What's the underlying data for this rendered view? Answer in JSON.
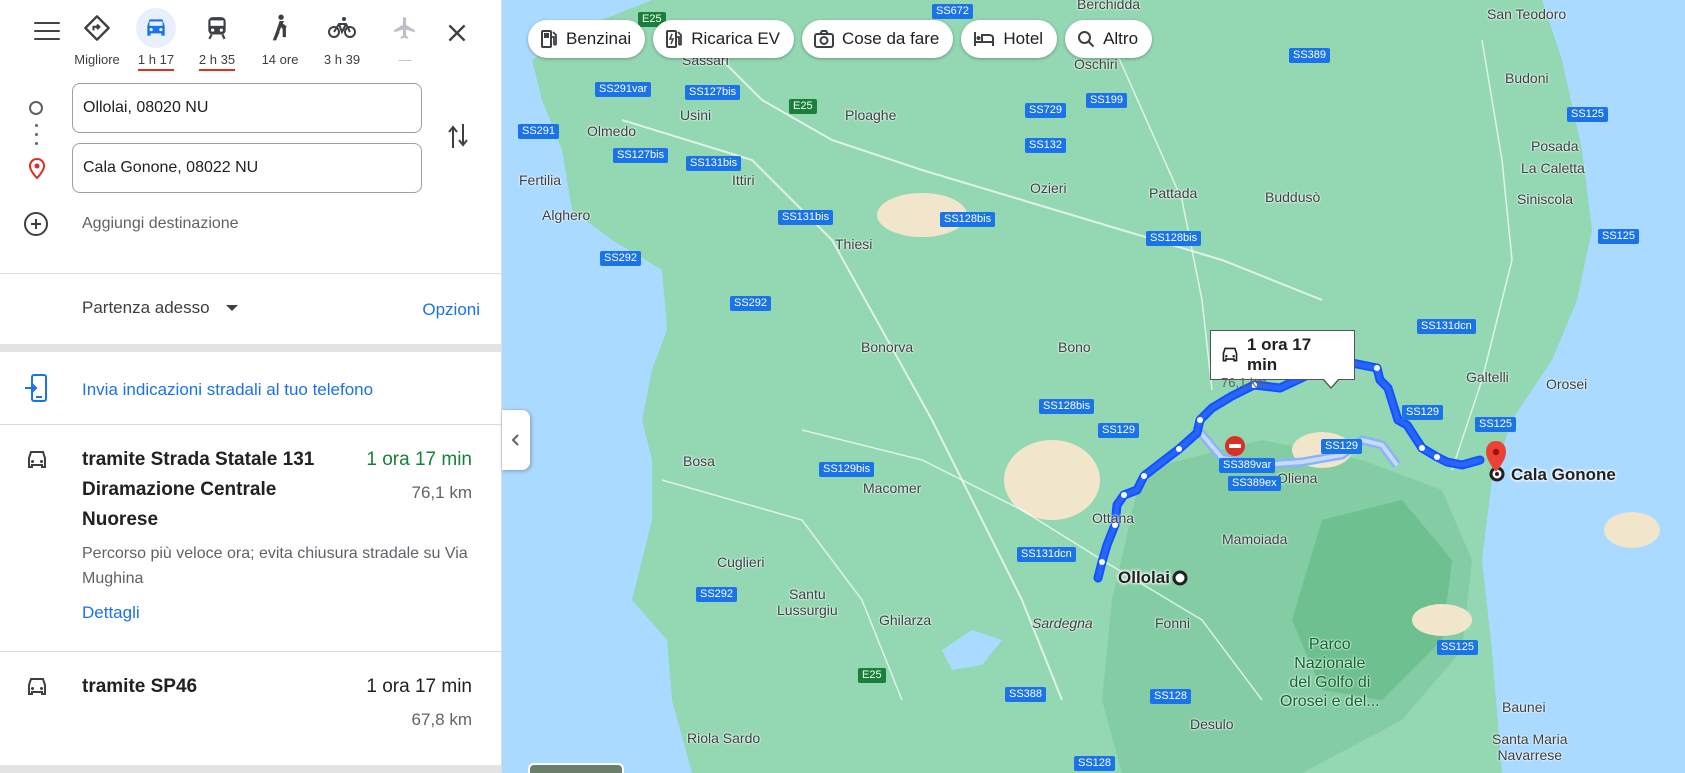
{
  "travel_modes": [
    {
      "name": "best",
      "label": "Migliore"
    },
    {
      "name": "car",
      "label": "1 h 17"
    },
    {
      "name": "transit",
      "label": "2 h 35"
    },
    {
      "name": "walk",
      "label": "14 ore"
    },
    {
      "name": "bike",
      "label": "3 h 39"
    },
    {
      "name": "flight",
      "label": "—"
    }
  ],
  "inputs": {
    "origin": "Ollolai, 08020 NU",
    "destination": "Cala Gonone, 08022 NU",
    "add_destination": "Aggiungi destinazione"
  },
  "departure": {
    "label": "Partenza adesso",
    "options": "Opzioni"
  },
  "send_to_phone": "Invia indicazioni stradali al tuo telefono",
  "routes": [
    {
      "name": "tramite Strada Statale 131 Diramazione Centrale Nuorese",
      "duration": "1 ora 17 min",
      "distance": "76,1 km",
      "description": "Percorso più veloce ora; evita chiusura stradale su Via Mughina",
      "details": "Dettagli",
      "duration_color": "#188038"
    },
    {
      "name": "tramite SP46",
      "duration": "1 ora 17 min",
      "distance": "67,8 km",
      "duration_color": "#202124"
    }
  ],
  "chips": [
    "Benzinai",
    "Ricarica EV",
    "Cose da fare",
    "Hotel",
    "Altro"
  ],
  "callout": {
    "duration": "1 ora 17 min",
    "distance": "76,1 km"
  },
  "map": {
    "places": {
      "berchidda": "Berchidda",
      "san_teodoro": "San Teodoro",
      "sassari": "Sassari",
      "oschiri": "Oschiri",
      "budoni": "Budoni",
      "usini": "Usini",
      "ploaghe": "Ploaghe",
      "olmedo": "Olmedo",
      "posada": "Posada",
      "la_caletta": "La Caletta",
      "fertilia": "Fertilia",
      "ittiri": "Ittiri",
      "ozieri": "Ozieri",
      "pattada": "Pattada",
      "budduso": "Buddusò",
      "siniscola": "Siniscola",
      "alghero": "Alghero",
      "thiesi": "Thiesi",
      "bonorva": "Bonorva",
      "bono": "Bono",
      "galtelli": "Galtelli",
      "orosei": "Orosei",
      "bosa": "Bosa",
      "oliena": "Oliena",
      "macomer": "Macomer",
      "ottana": "Ottana",
      "mamoiada": "Mamoiada",
      "cuglieri": "Cuglieri",
      "ollolai": "Ollolai",
      "cala_gonone": "Cala Gonone",
      "santu_lussurgiu": "Santu\nLussurgiu",
      "ghilarza": "Ghilarza",
      "sardegna": "Sardegna",
      "fonni": "Fonni",
      "desulo": "Desulo",
      "riola_sardo": "Riola Sardo",
      "baunei": "Baunei",
      "santa_maria": "Santa Maria\nNavarrese",
      "park": "Parco\nNazionale\ndel Golfo di\nOrosei e del..."
    },
    "shields": [
      "E25",
      "SS672",
      "SS389",
      "SS291var",
      "SS127bis",
      "E25",
      "SS291",
      "SS729",
      "SS199",
      "SS125",
      "SS127bis",
      "SS131bis",
      "SS132",
      "SS131bis",
      "SS128bis",
      "SS125",
      "SS128bis",
      "SS292",
      "SS292",
      "SS131dcn",
      "SS128bis",
      "SS129",
      "SS129",
      "SS125",
      "SS129bis",
      "SS389var",
      "SS389ex",
      "SS129",
      "SS131dcn",
      "SS292",
      "E25",
      "SS125",
      "SS388",
      "SS128",
      "SS128"
    ]
  }
}
